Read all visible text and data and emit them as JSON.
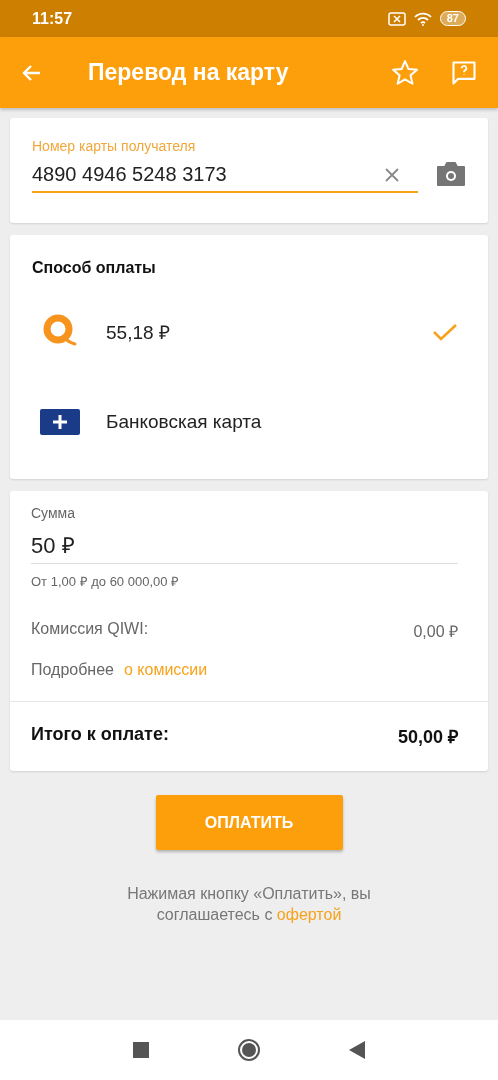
{
  "status_bar": {
    "time": "11:57",
    "battery": "87"
  },
  "app_bar": {
    "title": "Перевод на карту"
  },
  "card_field": {
    "label": "Номер карты получателя",
    "value": "4890 4946 5248 3173"
  },
  "payment": {
    "title": "Способ оплаты",
    "methods": [
      {
        "kind": "wallet",
        "label": "55,18 ₽",
        "selected": true
      },
      {
        "kind": "card",
        "label": "Банковская карта",
        "selected": false
      }
    ]
  },
  "amount": {
    "label": "Сумма",
    "value": "50 ₽",
    "hint": "От 1,00 ₽ до 60 000,00 ₽"
  },
  "commission": {
    "label": "Комиссия QIWI:",
    "value": "0,00 ₽"
  },
  "details": {
    "text": "Подробнее",
    "link": "о комиссии"
  },
  "total": {
    "label": "Итого к оплате:",
    "value": "50,00 ₽"
  },
  "pay_button": "ОПЛАТИТЬ",
  "agreement": {
    "text": "Нажимая кнопку «Оплатить», вы соглашаетесь с",
    "link": "офертой"
  }
}
